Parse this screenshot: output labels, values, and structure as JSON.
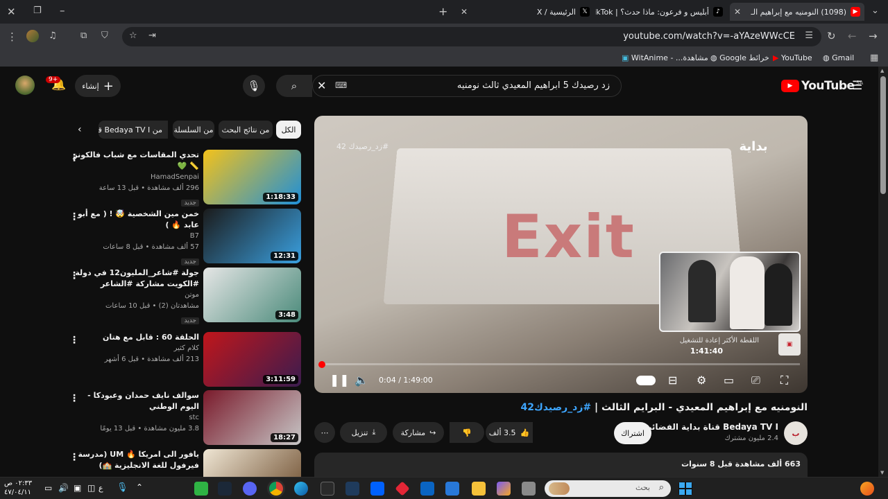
{
  "browser": {
    "tabs": [
      {
        "title": "(1098) النومنيه مع إبراهيم الـ",
        "active": true
      },
      {
        "title": "أبليس و فرعون: ماذا حدث؟ | TikTok",
        "active": false
      },
      {
        "title": "الرئيسية / X",
        "active": false
      }
    ],
    "url": "youtube.com/watch?v=-aYAzeWWcCE",
    "bookmarks": [
      "Gmail",
      "YouTube",
      "خرائط Google",
      "مشاهدة... - WitAnime"
    ]
  },
  "youtube": {
    "logo": "YouTube",
    "country": "SA",
    "search_query": "زد رصيدك 5 ابراهيم المعيدي ثالث نومنيه",
    "create_label": "إنشاء",
    "notif_count": "9+",
    "chips": [
      "الكل",
      "من نتائج البحث",
      "من السلسلة",
      "من Bedaya TV I قنا"
    ],
    "player": {
      "overlay_text": "Exit",
      "channel_watermark": "بداية",
      "hashtag": "#زد_رصيدك 42",
      "chapter": "اللقطة الأكثر إعادة للتشغيل",
      "preview_time": "1:41:40",
      "time": "0:04 / 1:49:00",
      "progress": 0.0006
    },
    "video_title_prefix": "النومنيه مع إبراهيم المعيدي - البرايم الثالث | ",
    "video_title_tag": "#زد_رصيدك42",
    "channel_name": "Bedaya TV I قناة بداية الفضائية",
    "subscribers": "2.4 مليون مشترك",
    "subscribe_label": "اشتراك",
    "likes": "3.5 ألف",
    "share_label": "مشاركة",
    "download_label": "تنزيل",
    "description_meta": "663 ألف مشاهدة  قبل 8 سنوات",
    "sidebar": [
      {
        "title": "تحدي المقاسات مع شباب فالكونز 📏 💚",
        "channel": "HamadSenpai",
        "meta": "296 ألف مشاهدة • قبل 13 ساعة",
        "badge": "جديد",
        "duration": "1:18:33",
        "colors": [
          "#f4c21a",
          "#1e8fd8"
        ]
      },
      {
        "title": "خمن مين الشخصية 🤯 ! ( مع أبو عابد 🔥 )",
        "channel": "B7",
        "meta": "57 ألف مشاهدة • قبل 8 ساعات",
        "badge": "جديد",
        "duration": "12:31",
        "colors": [
          "#1b1b1b",
          "#3aa0e0"
        ]
      },
      {
        "title": "جولة #شاعر_المليون12 في دولة #الكويت مشاركة #الشاعر #عبدالعزيز_تويني_العنزي",
        "channel": "موتن",
        "meta": "مشاهدتان (2) • قبل 10 ساعات",
        "badge": "جديد",
        "duration": "3:48",
        "colors": [
          "#e6e6e6",
          "#4a8a7a"
        ]
      },
      {
        "title": "الحلقة 60 : قابل مع هتان",
        "channel": "كلام كثير",
        "meta": "213 ألف مشاهدة • قبل 6 أشهر",
        "badge": "",
        "duration": "3:11:59",
        "colors": [
          "#c0161b",
          "#3b1c4f"
        ]
      },
      {
        "title": "سوالف نايف حمدان وعبودكا - اليوم الوطني",
        "channel": "stc",
        "meta": "3.8 مليون مشاهدة • قبل 13 يومًا",
        "badge": "",
        "duration": "18:27",
        "colors": [
          "#7a1a2b",
          "#c7c7c7"
        ]
      },
      {
        "title": "يافور الى امريكا 🔥 UM (مدرسة فيرفول للغة الانجليزية 🏫)",
        "channel": "",
        "meta": "",
        "badge": "",
        "duration": "",
        "colors": [
          "#efe6d4",
          "#6b4a2b"
        ]
      }
    ]
  },
  "taskbar": {
    "search_placeholder": "بحث",
    "time": "٠٢:٣٣ ص",
    "date": "٤٧/٠٤/١١",
    "lang": "ع"
  }
}
